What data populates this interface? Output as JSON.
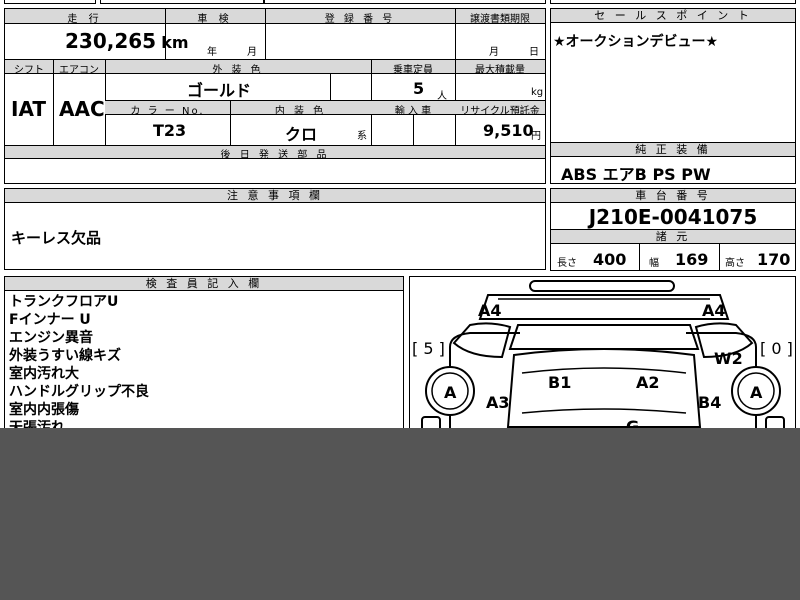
{
  "vehicle": {
    "mileage_header": "走 行",
    "mileage_value": "230,265",
    "mileage_unit": "km",
    "inspection_header": "車 検",
    "inspection_year": "年",
    "inspection_month": "月",
    "registration_header": "登 録 番 号",
    "transfer_header": "譲渡書類期限",
    "transfer_month": "月",
    "transfer_day": "日",
    "shift_header": "シフト",
    "ac_header": "エアコン",
    "shift_value": "IAT",
    "ac_value": "AAC",
    "exterior_color_header": "外 装 色",
    "exterior_color_value": "ゴールド",
    "capacity_header": "乗車定員",
    "capacity_value": "5",
    "capacity_unit": "人",
    "max_load_header": "最大積載量",
    "max_load_unit": "kg",
    "color_no_header": "カ ラ ー No.",
    "color_no_value": "T23",
    "interior_color_header": "内 装 色",
    "interior_color_value": "クロ",
    "interior_color_suffix": "系",
    "import_header": "輸 入 車",
    "recycle_header": "リサイクル預託金",
    "recycle_value": "9,510",
    "recycle_unit": "円",
    "later_parts_header": "後 日 発 送 部 品"
  },
  "sales_point": {
    "header": "セ ー ル ス ポ イ ン ト",
    "text": "★オークションデビュー★"
  },
  "equipment": {
    "header": "純 正 装 備",
    "text": "ABS エアB PS PW"
  },
  "notes": {
    "header": "注 意 事 項 欄",
    "text": "キーレス欠品"
  },
  "chassis": {
    "header": "車 台 番 号",
    "value": "J210E-0041075"
  },
  "dimensions": {
    "header": "諸 元",
    "length_label": "長さ",
    "length_value": "400",
    "width_label": "幅",
    "width_value": "169",
    "height_label": "高さ",
    "height_value": "170"
  },
  "inspector": {
    "header": "検 査 員 記 入 欄",
    "lines": [
      "トランクフロアU",
      "Fインナー U",
      "エンジン異音",
      "外装うすい線キズ",
      "室内汚れ大",
      "ハンドルグリップ不良",
      "室内内張傷",
      "天張汚れ"
    ]
  },
  "diagram": {
    "labels": {
      "a4_left": "A4",
      "a4_right": "A4",
      "bracket_left": "[ 5 ]",
      "bracket_right": "[ 0 ]",
      "w2": "W2",
      "b1": "B1",
      "a2": "A2",
      "a3": "A3",
      "b4": "B4",
      "wheel_left": "A",
      "wheel_right": "A",
      "g": "G"
    }
  },
  "colors": {
    "header_bg": "#d9d9d9",
    "overlay": "#555555"
  }
}
